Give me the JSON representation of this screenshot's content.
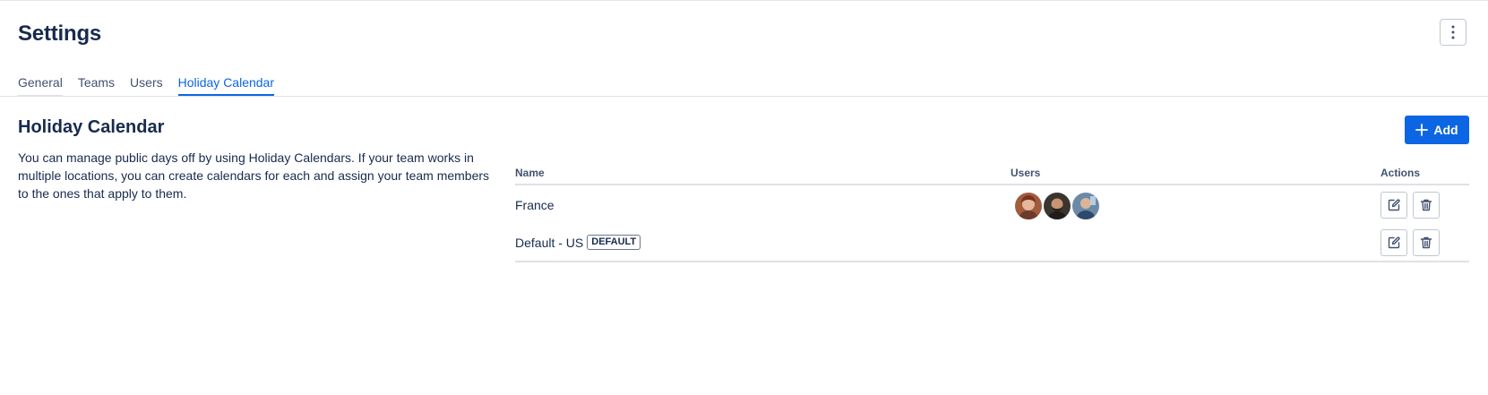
{
  "page": {
    "title": "Settings"
  },
  "header": {
    "more_icon": "more-vertical-icon"
  },
  "tabs": [
    {
      "label": "General",
      "active": false
    },
    {
      "label": "Teams",
      "active": false
    },
    {
      "label": "Users",
      "active": false
    },
    {
      "label": "Holiday Calendar",
      "active": true
    }
  ],
  "section": {
    "title": "Holiday Calendar",
    "description": "You can manage public days off by using Holiday Calendars. If your team works in multiple locations, you can create calendars for each and assign your team members to the ones that apply to them.",
    "add_label": "Add"
  },
  "table": {
    "columns": [
      "Name",
      "Users",
      "Actions"
    ],
    "rows": [
      {
        "name": "France",
        "badge": "",
        "users": [
          "avatar-user-1",
          "avatar-user-2",
          "avatar-user-3"
        ],
        "actions": [
          "edit-icon",
          "trash-icon"
        ]
      },
      {
        "name": "Default - US",
        "badge": "DEFAULT",
        "users": [],
        "actions": [
          "edit-icon",
          "trash-icon"
        ]
      }
    ]
  },
  "colors": {
    "accent": "#0c66e4",
    "text": "#172b4d",
    "border": "#dfe1e6"
  }
}
